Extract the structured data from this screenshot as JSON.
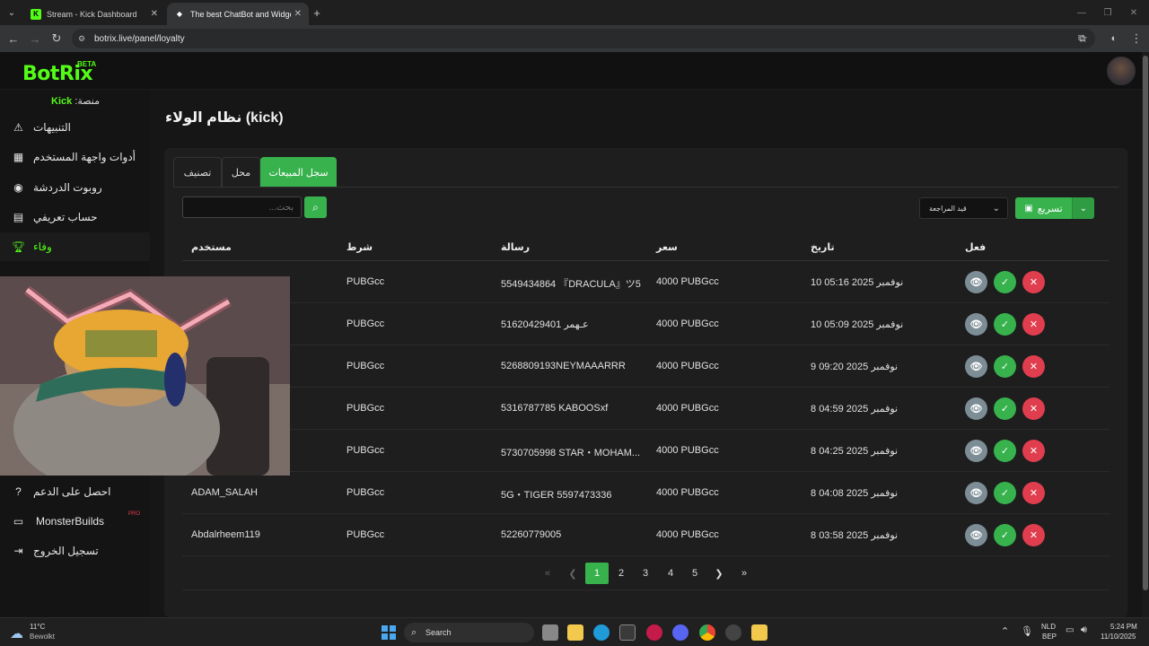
{
  "browser": {
    "tabs": [
      {
        "title": "Stream - Kick Dashboard",
        "fav": "K"
      },
      {
        "title": "The best ChatBot and Widgets",
        "fav": "◆"
      }
    ],
    "url": "botrix.live/panel/loyalty"
  },
  "app": {
    "logo": "BotRix",
    "beta": "BETA",
    "platform_label": "منصة:",
    "platform_value": "Kick"
  },
  "sidebar": {
    "items": [
      {
        "label": "التنبيهات",
        "icon": "warning-icon"
      },
      {
        "label": "أدوات واجهة المستخدم",
        "icon": "widgets-icon"
      },
      {
        "label": "روبوت الدردشة",
        "icon": "robot-icon"
      },
      {
        "label": "حساب تعريفي",
        "icon": "id-card-icon"
      },
      {
        "label": "وفاء",
        "icon": "trophy-icon"
      },
      {
        "label": "احصل على الدعم",
        "icon": "help-icon"
      },
      {
        "label": "MonsterBuilds",
        "icon": "laptop-icon",
        "badge": "PRO"
      },
      {
        "label": "تسجيل الخروج",
        "icon": "logout-icon"
      }
    ]
  },
  "page": {
    "title": "نظام الولاء (kick)"
  },
  "tabs": [
    "تصنيف",
    "محل",
    "سجل المبيعات"
  ],
  "toolbar": {
    "search_placeholder": "بحث...",
    "status_select": "قيد المراجعة",
    "export_label": "تسريع"
  },
  "table": {
    "headers": [
      "مستخدم",
      "شرط",
      "رسالة",
      "سعر",
      "تاريخ",
      "فعل"
    ],
    "rows": [
      {
        "user": "",
        "condition": "PUBGcc",
        "message": "5549434864 『DRACULA』ツ5",
        "price": "4000 PUBGcc",
        "date": "10 نوفمبر 2025 05:16"
      },
      {
        "user": "",
        "condition": "PUBGcc",
        "message": "51620429401 عـهمر",
        "price": "4000 PUBGcc",
        "date": "10 نوفمبر 2025 05:09"
      },
      {
        "user": "",
        "condition": "PUBGcc",
        "message": "5268809193NEYMAAARRR",
        "price": "4000 PUBGcc",
        "date": "9 نوفمبر 2025 09:20"
      },
      {
        "user": "",
        "condition": "PUBGcc",
        "message": "5316787785 KABOOSxf",
        "price": "4000 PUBGcc",
        "date": "8 نوفمبر 2025 04:59"
      },
      {
        "user": "",
        "condition": "PUBGcc",
        "message": "5730705998 STAR・MOHAM...",
        "price": "4000 PUBGcc",
        "date": "8 نوفمبر 2025 04:25"
      },
      {
        "user": "ADAM_SALAH",
        "condition": "PUBGcc",
        "message": "5G・TIGER 5597473336",
        "price": "4000 PUBGcc",
        "date": "8 نوفمبر 2025 04:08"
      },
      {
        "user": "Abdalrheem119",
        "condition": "PUBGcc",
        "message": "52260779005",
        "price": "4000 PUBGcc",
        "date": "8 نوفمبر 2025 03:58"
      }
    ]
  },
  "pagination": {
    "pages": [
      "1",
      "2",
      "3",
      "4",
      "5"
    ],
    "current": "1"
  },
  "taskbar": {
    "weather_temp": "11°C",
    "weather_desc": "Bewolkt",
    "search_label": "Search",
    "lang_1": "NLD",
    "lang_2": "BEP",
    "time": "5:24 PM",
    "date": "11/10/2025"
  },
  "colors": {
    "accent": "#37b24d",
    "brand": "#53fc18",
    "danger": "#e03e4e",
    "view": "#7d8d96"
  }
}
